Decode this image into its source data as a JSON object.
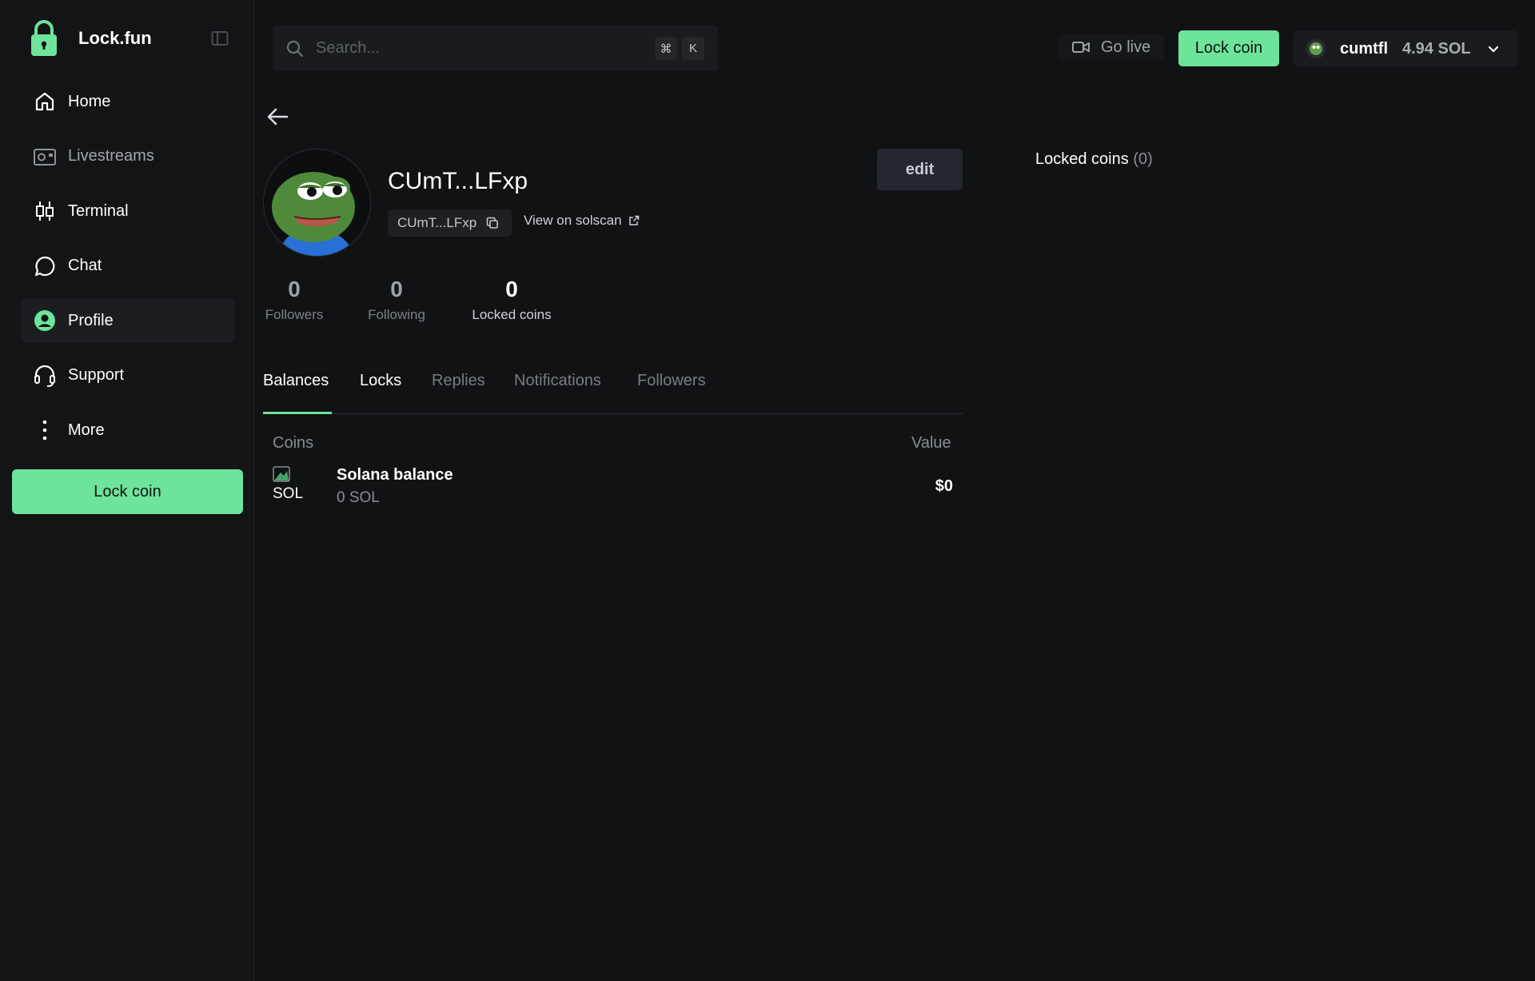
{
  "brand": {
    "name": "Lock.fun"
  },
  "sidebar": {
    "items": [
      {
        "label": "Home",
        "icon": "home-icon"
      },
      {
        "label": "Livestreams",
        "icon": "camera-icon"
      },
      {
        "label": "Terminal",
        "icon": "candles-icon"
      },
      {
        "label": "Chat",
        "icon": "chat-bubble-icon"
      },
      {
        "label": "Profile",
        "icon": "user-circle-icon"
      },
      {
        "label": "Support",
        "icon": "headset-icon"
      },
      {
        "label": "More",
        "icon": "more-vertical-icon"
      }
    ],
    "lock_button": "Lock coin"
  },
  "topbar": {
    "search_placeholder": "Search...",
    "shortcut_key1": "⌘",
    "shortcut_key2": "K",
    "go_live": "Go live",
    "lock_button": "Lock coin",
    "wallet_name": "cumtfl",
    "wallet_balance": "4.94 SOL"
  },
  "profile": {
    "name": "CUmT...LFxp",
    "address_short": "CUmT...LFxp",
    "solscan_link": "View on solscan",
    "edit_button": "edit",
    "stats": [
      {
        "value": "0",
        "label": "Followers"
      },
      {
        "value": "0",
        "label": "Following"
      },
      {
        "value": "0",
        "label": "Locked coins"
      }
    ]
  },
  "tabs": [
    "Balances",
    "Locks",
    "Replies",
    "Notifications",
    "Followers"
  ],
  "balances": {
    "col_coins": "Coins",
    "col_value": "Value",
    "rows": [
      {
        "ticker": "SOL",
        "title": "Solana balance",
        "amount": "0 SOL",
        "value": "$0"
      }
    ]
  },
  "locked_panel": {
    "title": "Locked coins",
    "count": "(0)"
  },
  "colors": {
    "accent": "#6ee39b",
    "background": "#111214",
    "sidebar": "#131416"
  }
}
